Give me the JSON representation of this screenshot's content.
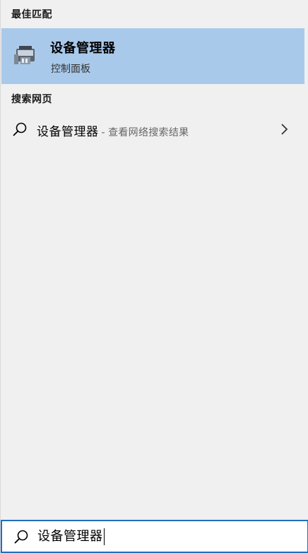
{
  "best_match": {
    "heading": "最佳匹配",
    "app_name": "设备管理器",
    "app_subtitle": "控制面板",
    "icon": "device-manager-icon",
    "highlight_color": "#a9c9ea"
  },
  "web": {
    "heading": "搜索网页",
    "query": "设备管理器",
    "separator": "-",
    "hint": "查看网络搜索结果",
    "icon": "search-icon",
    "chevron": "chevron-right-icon"
  },
  "search": {
    "value": "设备管理器",
    "icon": "search-icon",
    "border_color": "#1f6fc0"
  }
}
